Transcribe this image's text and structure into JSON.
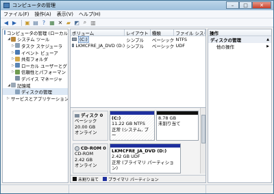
{
  "window": {
    "title": "コンピュータの管理",
    "buttons": {
      "minimize": "–",
      "maximize": "□",
      "close": "✕"
    }
  },
  "menu": [
    "ファイル(F)",
    "操作(A)",
    "表示(V)",
    "ヘルプ(H)"
  ],
  "toolbar": {
    "icons": [
      "back-arrow-icon",
      "forward-arrow-icon",
      "up-folder-icon",
      "show-tree-icon",
      "help-icon",
      "properties-icon",
      "delete-icon",
      "folder-icon",
      "save-icon",
      "search-icon",
      "disk-icon"
    ]
  },
  "tree": {
    "items": [
      {
        "label": "コンピュータの管理 (ローカル",
        "level": 0,
        "expander": "",
        "icon": "computer-icon"
      },
      {
        "label": "システム ツール",
        "level": 1,
        "expander": "◢",
        "icon": "tools-icon"
      },
      {
        "label": "タスク スケジューラ",
        "level": 2,
        "expander": "▷",
        "icon": "task-icon"
      },
      {
        "label": "イベント ビューア",
        "level": 2,
        "expander": "▷",
        "icon": "event-icon"
      },
      {
        "label": "共有フォルダ",
        "level": 2,
        "expander": "▷",
        "icon": "share-icon"
      },
      {
        "label": "ローカル ユーザーとグ",
        "level": 2,
        "expander": "▷",
        "icon": "users-icon"
      },
      {
        "label": "信頼性とパフォーマン",
        "level": 2,
        "expander": "▷",
        "icon": "performance-icon"
      },
      {
        "label": "デバイス マネージャ",
        "level": 2,
        "expander": "",
        "icon": "device-icon"
      },
      {
        "label": "記憶域",
        "level": 1,
        "expander": "◢",
        "icon": "storage-icon"
      },
      {
        "label": "ディスクの管理",
        "level": 2,
        "expander": "",
        "icon": "disk-icon",
        "selected": true
      },
      {
        "label": "サービスとアプリケーション",
        "level": 1,
        "expander": "▷",
        "icon": "services-icon"
      }
    ]
  },
  "list": {
    "headers": [
      "ボリューム",
      "レイアウト",
      "種類",
      "ファイル システ"
    ],
    "rows": [
      {
        "volume": "(C:)",
        "layout": "シンプル",
        "type": "ベーシック",
        "fs": "NTFS",
        "selected": true
      },
      {
        "volume": "LKMCFRE_JA_DVD (D:)",
        "layout": "シンプル",
        "type": "ベーシック",
        "fs": "UDF",
        "selected": false
      }
    ]
  },
  "disks": [
    {
      "name": "ディスク 0",
      "kind": "ベーシック",
      "size": "20.00 GB",
      "status": "オンライン",
      "partitions": [
        {
          "title": "(C:)",
          "line1": "11.22 GB NTFS",
          "line2": "正常 (システム, ブー",
          "bar": "primary"
        },
        {
          "title": "",
          "line1": "8.78 GB",
          "line2": "未割り当て",
          "bar": "black"
        }
      ]
    },
    {
      "name": "CD-ROM 0",
      "kind": "CD-ROM",
      "size": "2.42 GB",
      "status": "オンライン",
      "partitions": [
        {
          "title": "LKMCFRE_JA_DVD  (D:)",
          "line1": "2.42 GB UDF",
          "line2": "正常 (プライマリ パーティション)",
          "bar": "primary"
        }
      ]
    }
  ],
  "legend": [
    {
      "label": "未割り当て",
      "color": "#111111"
    },
    {
      "label": "プライマリ パーティション",
      "color": "#1e2f9e"
    }
  ],
  "actions": {
    "header": "操作",
    "section": "ディスクの管理",
    "items": [
      "他の操作"
    ]
  }
}
